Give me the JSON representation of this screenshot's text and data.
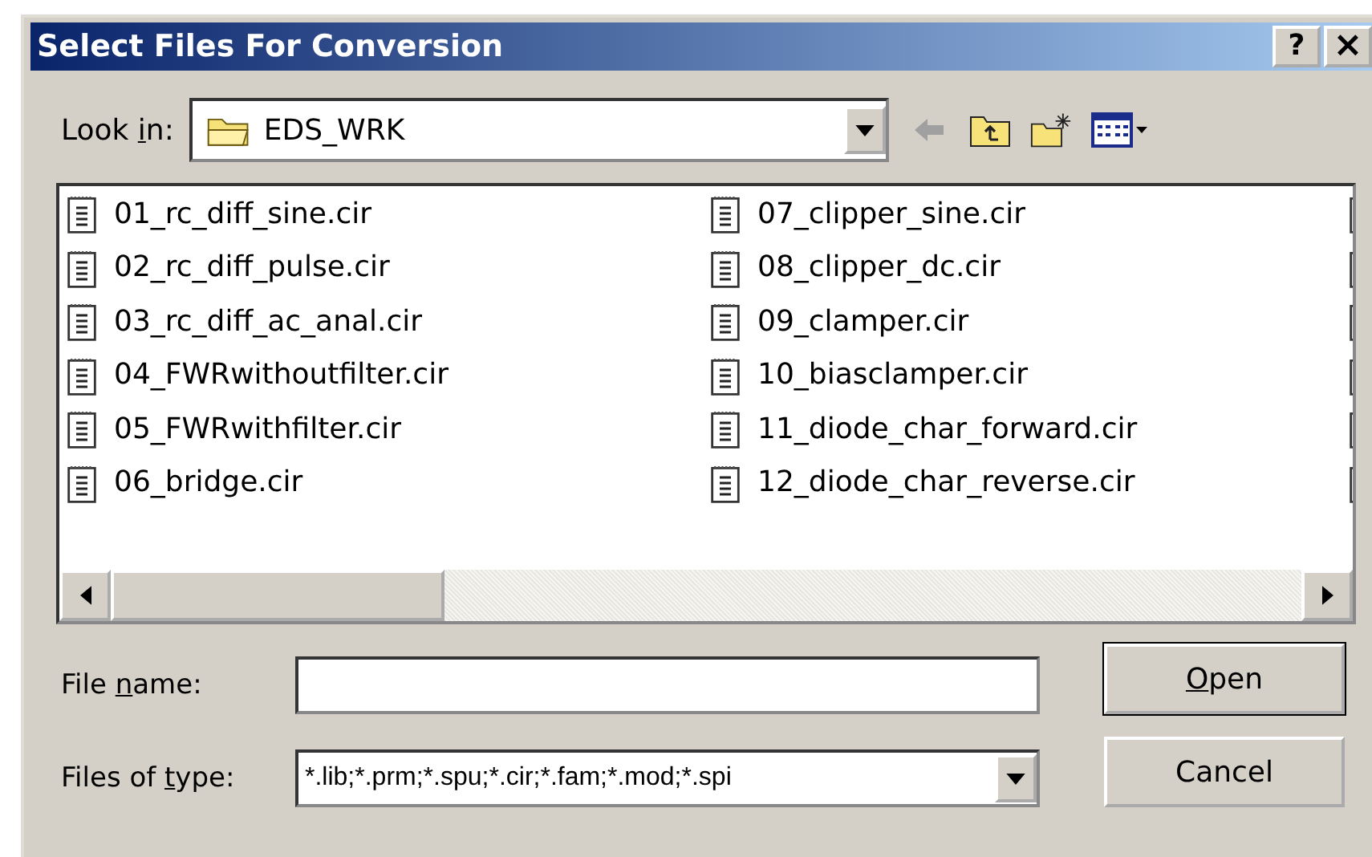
{
  "window": {
    "title": "Select Files For Conversion",
    "buttons": [
      {
        "kind": "help",
        "label": "?"
      },
      {
        "kind": "close",
        "label": "×"
      }
    ]
  },
  "look_in": {
    "label": {
      "before": "Look ",
      "key": "i",
      "after": "n:"
    },
    "value": "EDS_WRK"
  },
  "files": [
    {
      "kind": "file",
      "name": "01_rc_diff_sine.cir"
    },
    {
      "kind": "file",
      "name": "02_rc_diff_pulse.cir"
    },
    {
      "kind": "file",
      "name": "03_rc_diff_ac_anal.cir"
    },
    {
      "kind": "file",
      "name": "04_FWRwithoutfilter.cir"
    },
    {
      "kind": "file",
      "name": "05_FWRwithfilter.cir"
    },
    {
      "kind": "file",
      "name": "06_bridge.cir"
    },
    {
      "kind": "file",
      "name": "07_clipper_sine.cir"
    },
    {
      "kind": "file",
      "name": "08_clipper_dc.cir"
    },
    {
      "kind": "file",
      "name": "09_clamper.cir"
    },
    {
      "kind": "file",
      "name": "10_biasclamper.cir"
    },
    {
      "kind": "file",
      "name": "11_diode_char_forward.cir"
    },
    {
      "kind": "file",
      "name": "12_diode_char_reverse.cir"
    },
    {
      "kind": "cut_file"
    },
    {
      "kind": "cut_file"
    },
    {
      "kind": "cut_file"
    },
    {
      "kind": "cut_file"
    },
    {
      "kind": "cut_file"
    },
    {
      "kind": "cut_file"
    }
  ],
  "file_name": {
    "label": {
      "before": "File ",
      "key": "n",
      "after": "ame:"
    }
  },
  "files_of_type": {
    "label": {
      "before": "Files of ",
      "key": "t",
      "after": "ype:"
    },
    "value": "*.lib;*.prm;*.spu;*.cir;*.fam;*.mod;*.spi"
  },
  "buttons": [
    {
      "kind": "default",
      "label": {
        "key": "O",
        "after": "pen"
      }
    },
    {
      "kind": "normal",
      "label": {
        "after": "Cancel"
      }
    }
  ]
}
